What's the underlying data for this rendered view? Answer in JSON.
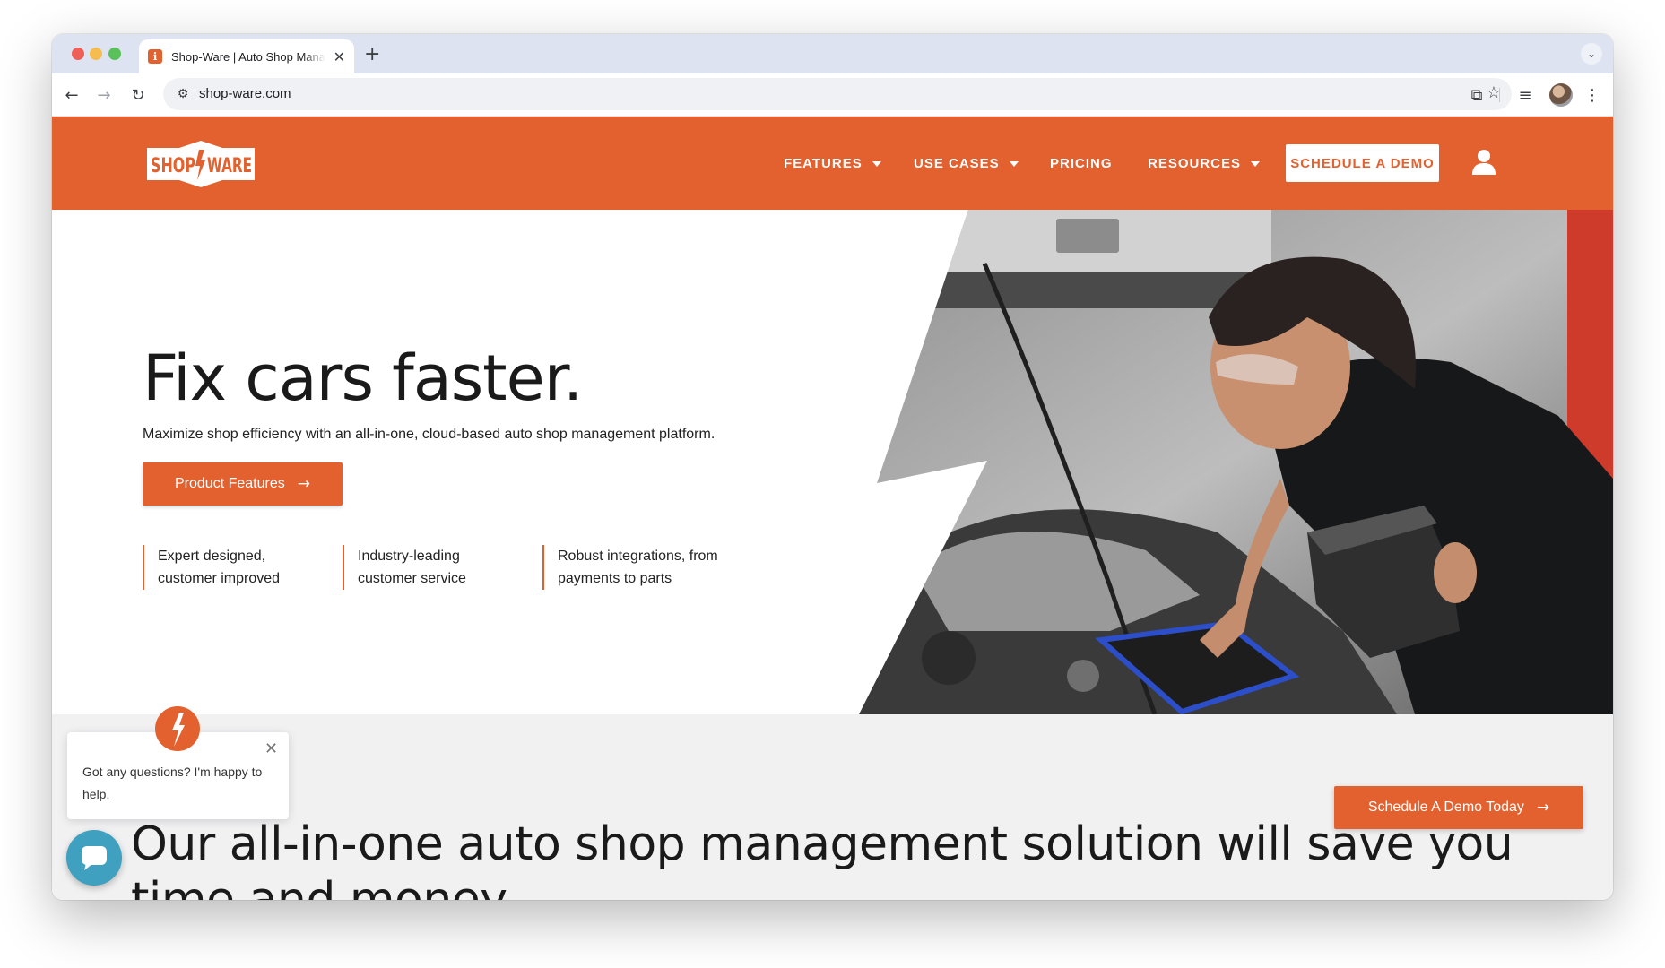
{
  "browser": {
    "tab_title": "Shop-Ware | Auto Shop Management Software",
    "tab_favicon": "ℹ",
    "tab_close": "✕",
    "new_tab": "+",
    "tab_menu": "⌄",
    "url": "shop-ware.com",
    "icons": {
      "back": "←",
      "forward": "→",
      "reload": "↻",
      "site_info": "⚙",
      "bookmark": "☆",
      "extensions": "⧉",
      "media": "≡",
      "menu": "⋮"
    }
  },
  "brand": {
    "logo_left": "SHOP",
    "logo_right": "WARE",
    "accent_color": "#e2612f",
    "text_dark": "#1a1a1a",
    "section_bg": "#f1f1f2",
    "chat_color": "#3fa0bf"
  },
  "nav": {
    "items": [
      {
        "label": "FEATURES",
        "has_dropdown": true
      },
      {
        "label": "USE CASES",
        "has_dropdown": true
      },
      {
        "label": "PRICING",
        "has_dropdown": false
      },
      {
        "label": "RESOURCES",
        "has_dropdown": true
      }
    ],
    "cta": "SCHEDULE A DEMO",
    "user_icon": "user-icon"
  },
  "hero": {
    "title": "Fix cars faster.",
    "subtitle": "Maximize shop efficiency with an all-in-one, cloud-based auto shop management platform.",
    "button_label": "Product Features",
    "button_arrow": "→",
    "features": [
      {
        "line1": "Expert designed,",
        "line2": "customer improved"
      },
      {
        "line1": "Industry-leading",
        "line2": "customer service"
      },
      {
        "line1": "Robust integrations, from",
        "line2": "payments to parts"
      }
    ]
  },
  "section2": {
    "heading": "Our all-in-one auto shop management solution will save you time and money",
    "demo_button": "Schedule A Demo Today",
    "demo_arrow": "→"
  },
  "chat": {
    "message": "Got any questions? I'm happy to help.",
    "close": "✕"
  }
}
